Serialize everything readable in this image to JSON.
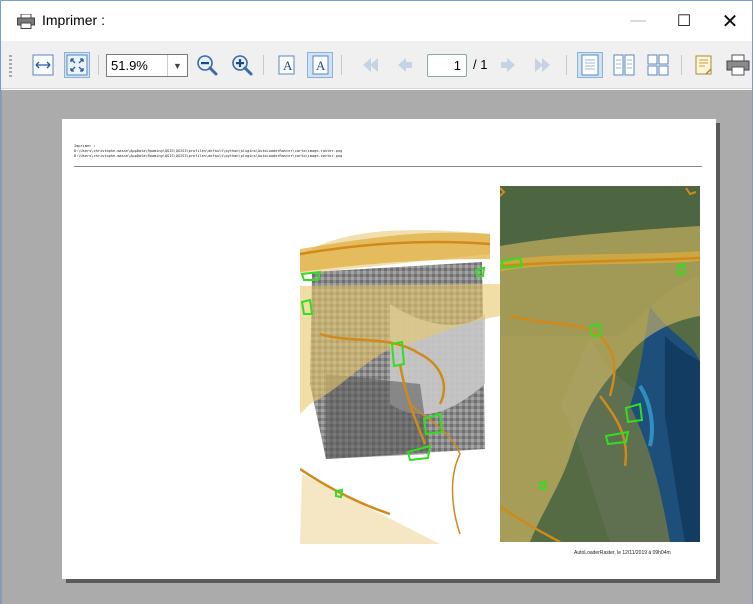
{
  "window": {
    "title": "Imprimer :",
    "title_icon": "printer-icon",
    "buttons": {
      "minimize": "—",
      "maximize": "☐",
      "close": "✕"
    }
  },
  "toolbar": {
    "zoom_value": "51.9%",
    "page_current": "1",
    "page_total": "/ 1",
    "icons": [
      "fit-width-icon",
      "fit-page-icon",
      "zoom-out-icon",
      "zoom-in-icon",
      "text-a-icon",
      "text-a-pressed-icon",
      "first-page-icon",
      "previous-page-icon",
      "next-page-icon",
      "last-page-icon",
      "single-page-view-icon",
      "two-page-view-icon",
      "four-page-view-icon",
      "page-setup-icon",
      "print-icon"
    ]
  },
  "document": {
    "header_lines": [
      "Imprimer :",
      "D:\\Users\\christophe.masse\\AppData\\Roaming\\QGIS\\QGIS3\\profiles\\default\\python\\plugins\\AutoLoaderRaster\\carto\\image-raster.png",
      "D:\\Users\\christophe.masse\\AppData\\Roaming\\QGIS\\QGIS3\\profiles\\default\\python\\plugins\\AutoLoaderRaster\\carto\\image-vector.png"
    ],
    "footer": "AutoLoaderRaster, le 12/11/2019 à 09h04m"
  },
  "colors": {
    "preview_bg": "#ababab",
    "overlay_yellow": "#e8c76a",
    "contour_orange": "#d08a1a",
    "polygon_green": "#33dd22",
    "sea_blue": "#1d4f7a"
  }
}
